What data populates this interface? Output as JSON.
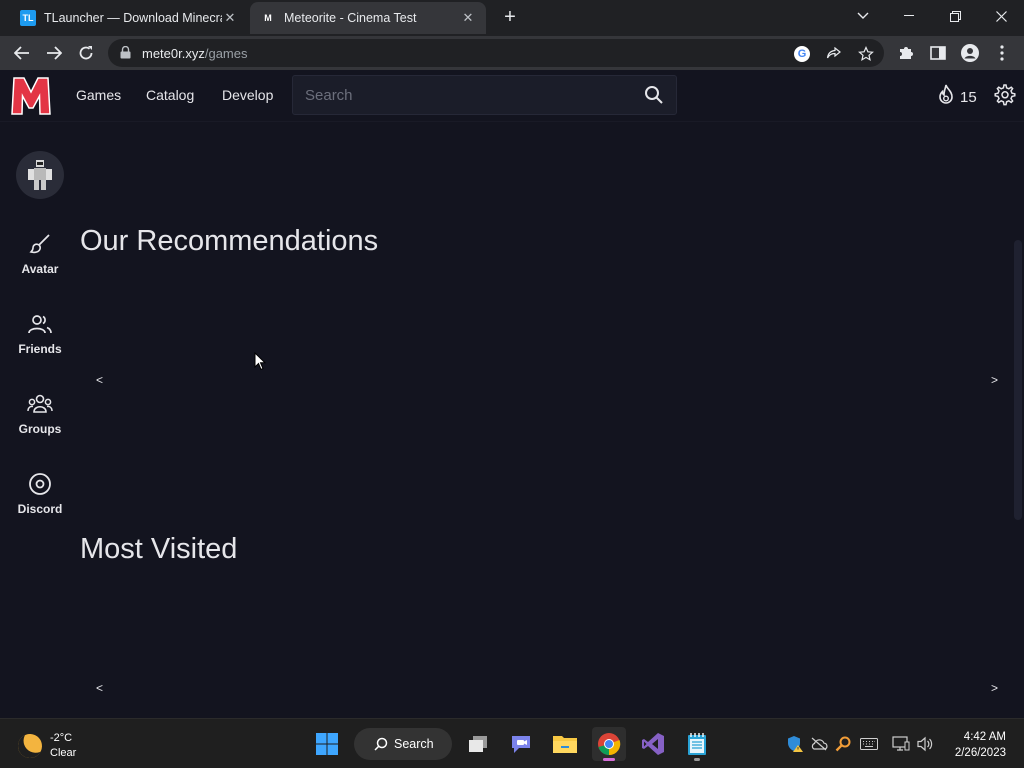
{
  "browser": {
    "tabs": [
      {
        "label": "TLauncher — Download Minecraft",
        "favicon": "TL",
        "active": false
      },
      {
        "label": "Meteorite - Cinema Test",
        "favicon": "M",
        "active": true
      }
    ],
    "new_tab_label": "+",
    "url_host": "mete0r.xyz",
    "url_path": "/games"
  },
  "site": {
    "logo_letter": "M",
    "logo_color": "#e33545",
    "nav": [
      "Games",
      "Catalog",
      "Develop"
    ],
    "search_placeholder": "Search",
    "currency_amount": "15",
    "sidebar": [
      {
        "label": "Avatar",
        "icon": "brush-icon"
      },
      {
        "label": "Friends",
        "icon": "friends-icon"
      },
      {
        "label": "Groups",
        "icon": "groups-icon"
      },
      {
        "label": "Discord",
        "icon": "discord-icon"
      }
    ],
    "sections": [
      {
        "title": "Our Recommendations",
        "prev": "<",
        "next": ">"
      },
      {
        "title": "Most Visited",
        "prev": "<",
        "next": ">"
      }
    ]
  },
  "taskbar": {
    "weather_temp": "-2°C",
    "weather_condition": "Clear",
    "search_label": "Search",
    "time": "4:42 AM",
    "date": "2/26/2023"
  }
}
